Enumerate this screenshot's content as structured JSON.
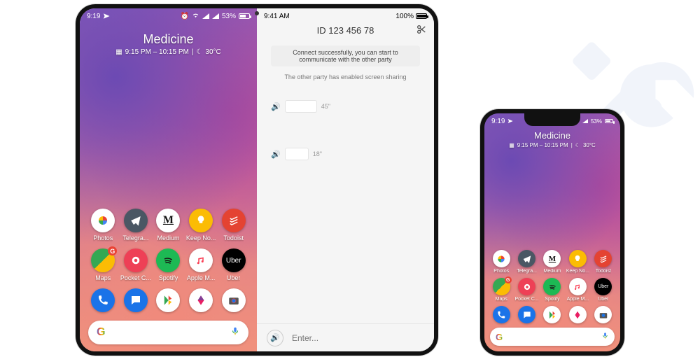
{
  "status": {
    "time": "9:19",
    "battery_pct": "53%",
    "send_icon": "paper-plane"
  },
  "widget": {
    "title": "Medicine",
    "subtitle": "9:15 PM – 10:15 PM",
    "temp": "30°C"
  },
  "apps": {
    "row1": [
      {
        "name": "Photos",
        "label": "Photos"
      },
      {
        "name": "Telegram",
        "label": "Telegra..."
      },
      {
        "name": "Medium",
        "label": "Medium"
      },
      {
        "name": "Keep",
        "label": "Keep No..."
      },
      {
        "name": "Todoist",
        "label": "Todoist"
      }
    ],
    "row2": [
      {
        "name": "Maps",
        "label": "Maps"
      },
      {
        "name": "Pocket",
        "label": "Pocket C..."
      },
      {
        "name": "Spotify",
        "label": "Spotify"
      },
      {
        "name": "AppleMusic",
        "label": "Apple M..."
      },
      {
        "name": "Uber",
        "label": "Uber"
      }
    ],
    "dock": [
      {
        "name": "Phone"
      },
      {
        "name": "Messages"
      },
      {
        "name": "PlayStore"
      },
      {
        "name": "Gallery"
      },
      {
        "name": "Camera"
      }
    ]
  },
  "search": {
    "brand": "G"
  },
  "rightpane": {
    "status_time": "9:41 AM",
    "status_batt": "100%",
    "title": "ID 123 456 78",
    "banner": "Connect successfully, you can start to communicate with the other party",
    "note": "The other party has enabled screen sharing",
    "msg1_time": "45\"",
    "msg2_time": "18\"",
    "input_placeholder": "Enter..."
  }
}
